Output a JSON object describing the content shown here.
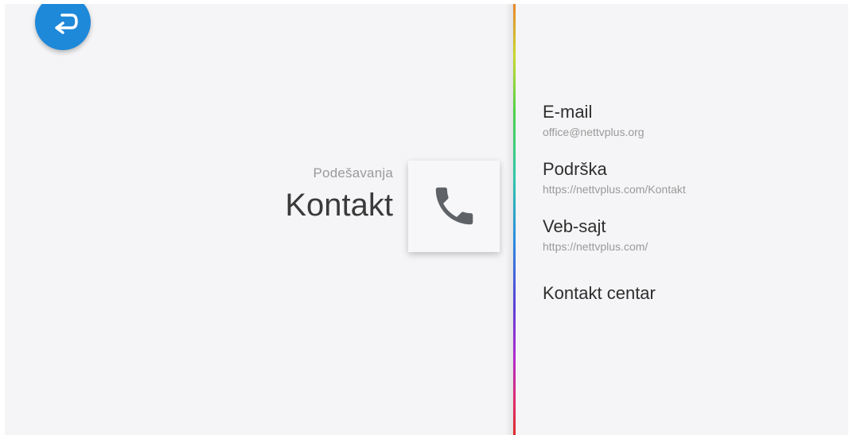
{
  "header": {
    "breadcrumb": "Podešavanja",
    "title": "Kontakt"
  },
  "icons": {
    "back": "back-arrow-icon",
    "tile": "phone-icon"
  },
  "colors": {
    "back_button": "#1e88d9",
    "background": "#f5f5f7",
    "icon_gray": "#5f6368"
  },
  "menu": {
    "items": [
      {
        "title": "E-mail",
        "subtitle": "office@nettvplus.org"
      },
      {
        "title": "Podrška",
        "subtitle": "https://nettvplus.com/Kontakt"
      },
      {
        "title": "Veb-sajt",
        "subtitle": "https://nettvplus.com/"
      },
      {
        "title": "Kontakt centar",
        "subtitle": ""
      }
    ]
  }
}
